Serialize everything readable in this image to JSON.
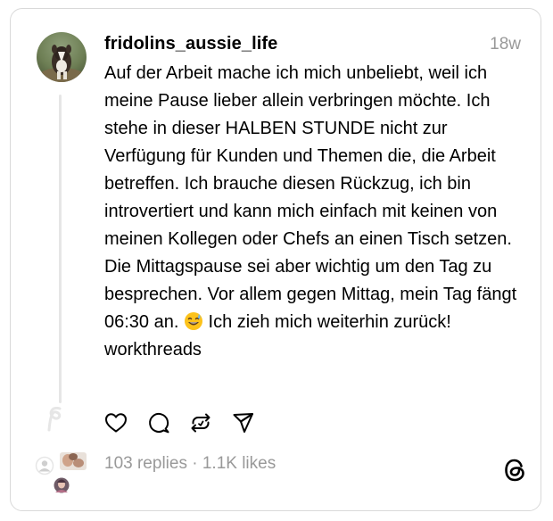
{
  "post": {
    "username": "fridolins_aussie_life",
    "timestamp": "18w",
    "text_part1": "Auf der Arbeit mache ich mich unbeliebt, weil ich meine Pause lieber allein verbringen möchte. Ich stehe in dieser HALBEN STUNDE nicht zur Verfügung für Kunden und Themen die, die Arbeit betreffen. Ich brauche diesen Rückzug, ich bin introvertiert und kann mich einfach mit keinen von meinen Kollegen oder Chefs an einen Tisch setzen. Die Mittagspause sei aber wichtig um den Tag zu besprechen. Vor allem gegen Mittag, mein Tag fängt 06:30 an.",
    "emoji": "😅",
    "text_part2": " Ich zieh mich weiterhin zurück! workthreads"
  },
  "actions": {
    "like": "heart-icon",
    "reply": "comment-icon",
    "repost": "repost-icon",
    "share": "send-icon"
  },
  "stats": {
    "replies": "103 replies",
    "separator": " · ",
    "likes": "1.1K likes"
  },
  "colors": {
    "text": "#000000",
    "muted": "#999999",
    "border": "#d9d9d9",
    "thread_line": "#e6e6e6"
  }
}
